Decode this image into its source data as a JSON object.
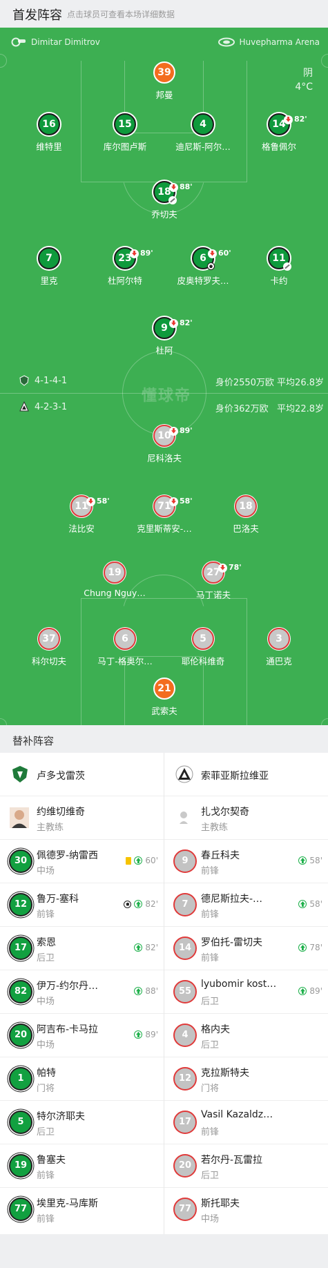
{
  "header": {
    "title": "首发阵容",
    "subtitle": "点击球员可查看本场详细数据"
  },
  "pitch": {
    "home_coach_side": "Dimitar Dimitrov",
    "stadium": "Huvepharma Arena",
    "weather": "阴",
    "temperature": "4°C",
    "watermark": "懂球帝",
    "home_formation": "4-1-4-1",
    "home_value": "身价2550万欧",
    "home_age": "平均26.8岁",
    "away_formation": "4-2-3-1",
    "away_value": "身价362万欧",
    "away_age": "平均22.8岁"
  },
  "home_players": [
    {
      "num": "39",
      "name": "邦曼",
      "kind": "gk"
    },
    {
      "num": "16",
      "name": "维特里",
      "kind": "home"
    },
    {
      "num": "15",
      "name": "库尔图卢斯",
      "kind": "home"
    },
    {
      "num": "4",
      "name": "迪尼斯-阿尔…",
      "kind": "home"
    },
    {
      "num": "14",
      "name": "格鲁佩尔",
      "kind": "home",
      "sub": "82'"
    },
    {
      "num": "18",
      "name": "乔切夫",
      "kind": "home",
      "sub": "88'"
    },
    {
      "num": "7",
      "name": "里克",
      "kind": "home"
    },
    {
      "num": "23",
      "name": "杜阿尔特",
      "kind": "home",
      "sub": "89'"
    },
    {
      "num": "6",
      "name": "皮奥特罗夫…",
      "kind": "home",
      "sub": "60'"
    },
    {
      "num": "11",
      "name": "卡约",
      "kind": "home"
    },
    {
      "num": "9",
      "name": "杜阿",
      "kind": "home",
      "sub": "82'"
    }
  ],
  "away_players": [
    {
      "num": "10",
      "name": "尼科洛夫",
      "kind": "away",
      "sub": "89'"
    },
    {
      "num": "11",
      "name": "法比安",
      "kind": "away",
      "sub": "58'"
    },
    {
      "num": "71",
      "name": "克里斯蒂安-…",
      "kind": "away",
      "sub": "58'"
    },
    {
      "num": "18",
      "name": "巴洛夫",
      "kind": "away"
    },
    {
      "num": "19",
      "name": "Chung Nguy…",
      "kind": "away"
    },
    {
      "num": "27",
      "name": "马丁诺夫",
      "kind": "away",
      "sub": "78'"
    },
    {
      "num": "37",
      "name": "科尔切夫",
      "kind": "away"
    },
    {
      "num": "6",
      "name": "马丁-格奥尔…",
      "kind": "away"
    },
    {
      "num": "5",
      "name": "耶伦科维奇",
      "kind": "away"
    },
    {
      "num": "3",
      "name": "通巴克",
      "kind": "away"
    },
    {
      "num": "21",
      "name": "武索夫",
      "kind": "gk"
    }
  ],
  "subs_header": "替补阵容",
  "home_team": "卢多戈雷茨",
  "away_team": "索菲亚斯拉维亚",
  "home_coach": {
    "name": "约维切维奇",
    "role": "主教练"
  },
  "away_coach": {
    "name": "扎戈尔契奇",
    "role": "主教练"
  },
  "home_subs": [
    {
      "num": "30",
      "name": "佩德罗-纳雷西",
      "pos": "中场",
      "minute": "60'",
      "yellow": true
    },
    {
      "num": "12",
      "name": "鲁万-塞科",
      "pos": "前锋",
      "minute": "82'",
      "goal": true
    },
    {
      "num": "17",
      "name": "索恩",
      "pos": "后卫",
      "minute": "82'"
    },
    {
      "num": "82",
      "name": "伊万-约尔丹…",
      "pos": "中场",
      "minute": "88'"
    },
    {
      "num": "20",
      "name": "阿吉布-卡马拉",
      "pos": "中场",
      "minute": "89'"
    },
    {
      "num": "1",
      "name": "帕特",
      "pos": "门将"
    },
    {
      "num": "5",
      "name": "特尔济耶夫",
      "pos": "后卫"
    },
    {
      "num": "19",
      "name": "鲁塞夫",
      "pos": "前锋"
    },
    {
      "num": "77",
      "name": "埃里克-马库斯",
      "pos": "前锋"
    }
  ],
  "away_subs": [
    {
      "num": "9",
      "name": "春丘科夫",
      "pos": "前锋",
      "minute": "58'"
    },
    {
      "num": "7",
      "name": "德尼斯拉夫-…",
      "pos": "前锋",
      "minute": "58'"
    },
    {
      "num": "14",
      "name": "罗伯托-雷切夫",
      "pos": "前锋",
      "minute": "78'"
    },
    {
      "num": "55",
      "name": "lyubomir kost…",
      "pos": "后卫",
      "minute": "89'"
    },
    {
      "num": "4",
      "name": "格内夫",
      "pos": "后卫"
    },
    {
      "num": "12",
      "name": "克拉斯特夫",
      "pos": "门将"
    },
    {
      "num": "17",
      "name": "Vasil Kazaldz…",
      "pos": "前锋"
    },
    {
      "num": "20",
      "name": "若尔丹-瓦雷拉",
      "pos": "后卫"
    },
    {
      "num": "77",
      "name": "斯托耶夫",
      "pos": "中场"
    }
  ]
}
